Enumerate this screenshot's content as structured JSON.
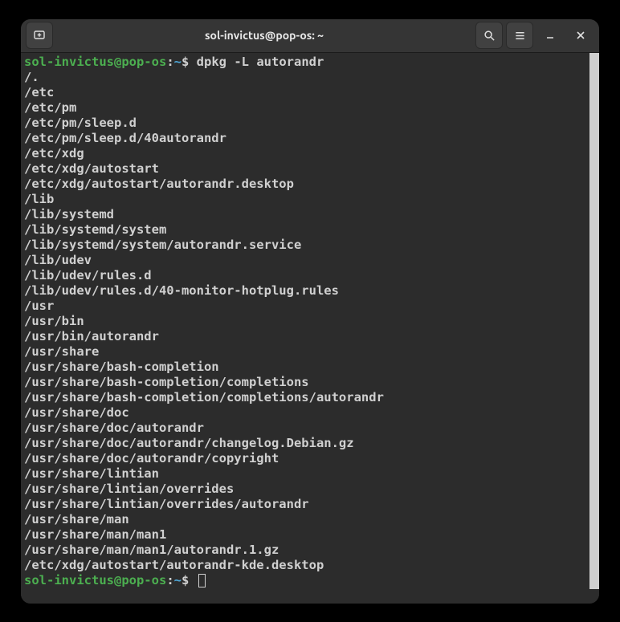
{
  "window": {
    "title": "sol-invictus@pop-os: ~"
  },
  "prompt": {
    "user_host": "sol-invictus@pop-os",
    "separator": ":",
    "path": "~",
    "symbol": "$"
  },
  "session": {
    "command": "dpkg -L autorandr",
    "output": [
      "/.",
      "/etc",
      "/etc/pm",
      "/etc/pm/sleep.d",
      "/etc/pm/sleep.d/40autorandr",
      "/etc/xdg",
      "/etc/xdg/autostart",
      "/etc/xdg/autostart/autorandr.desktop",
      "/lib",
      "/lib/systemd",
      "/lib/systemd/system",
      "/lib/systemd/system/autorandr.service",
      "/lib/udev",
      "/lib/udev/rules.d",
      "/lib/udev/rules.d/40-monitor-hotplug.rules",
      "/usr",
      "/usr/bin",
      "/usr/bin/autorandr",
      "/usr/share",
      "/usr/share/bash-completion",
      "/usr/share/bash-completion/completions",
      "/usr/share/bash-completion/completions/autorandr",
      "/usr/share/doc",
      "/usr/share/doc/autorandr",
      "/usr/share/doc/autorandr/changelog.Debian.gz",
      "/usr/share/doc/autorandr/copyright",
      "/usr/share/lintian",
      "/usr/share/lintian/overrides",
      "/usr/share/lintian/overrides/autorandr",
      "/usr/share/man",
      "/usr/share/man/man1",
      "/usr/share/man/man1/autorandr.1.gz",
      "/etc/xdg/autostart/autorandr-kde.desktop"
    ]
  }
}
